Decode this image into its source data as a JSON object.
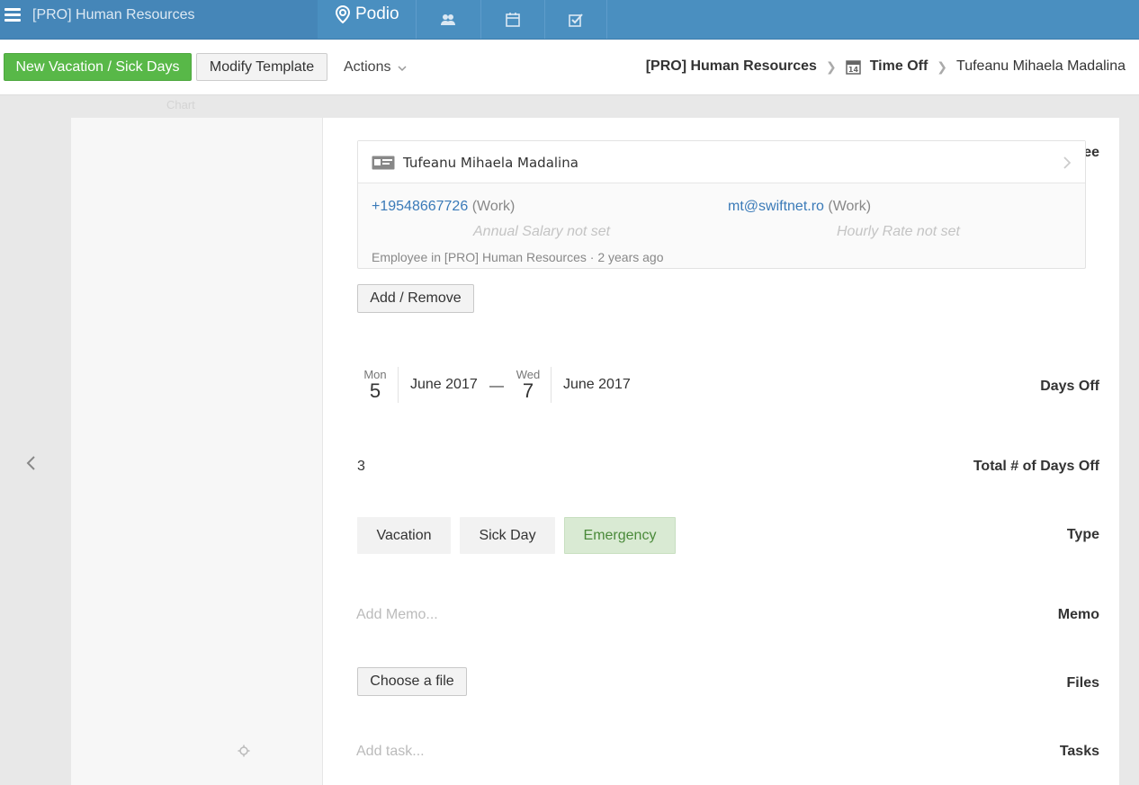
{
  "topbar": {
    "workspace_title": "[PRO] Human Resources",
    "logo_text": "Podio"
  },
  "toolbar": {
    "new_button": "New Vacation / Sick Days",
    "modify_button": "Modify Template",
    "actions_label": "Actions"
  },
  "breadcrumb": {
    "workspace": "[PRO] Human Resources",
    "app": "Time Off",
    "item": "Tufeanu Mihaela Madalina"
  },
  "background_hints": {
    "chart_word": "Chart"
  },
  "fields": {
    "employee_label": "Employee",
    "required_mark": "*",
    "days_off_label": "Days Off",
    "total_label": "Total # of Days Off",
    "type_label": "Type",
    "memo_label": "Memo",
    "files_label": "Files",
    "tasks_label": "Tasks"
  },
  "employee": {
    "name": "Tufeanu Mihaela Madalina",
    "phone": "+19548667726",
    "phone_type": "(Work)",
    "email": "mt@swiftnet.ro",
    "email_type": "(Work)",
    "salary": "Annual Salary not set",
    "hourly": "Hourly Rate not set",
    "meta": "Employee in [PRO] Human Resources · 2 years ago",
    "add_remove": "Add / Remove"
  },
  "days_off": {
    "start_dow": "Mon",
    "start_day": "5",
    "start_month": "June 2017",
    "separator": "—",
    "end_dow": "Wed",
    "end_day": "7",
    "end_month": "June 2017"
  },
  "total_days": "3",
  "type": {
    "options": [
      "Vacation",
      "Sick Day",
      "Emergency"
    ],
    "selected": "Emergency"
  },
  "memo_placeholder": "Add Memo...",
  "files_button": "Choose a file",
  "tasks_placeholder": "Add task...",
  "colors": {
    "topbar": "#4a8fc0",
    "accent_green": "#58b848",
    "link_blue": "#3a7ab8",
    "selected_bg": "#d9ead3"
  }
}
